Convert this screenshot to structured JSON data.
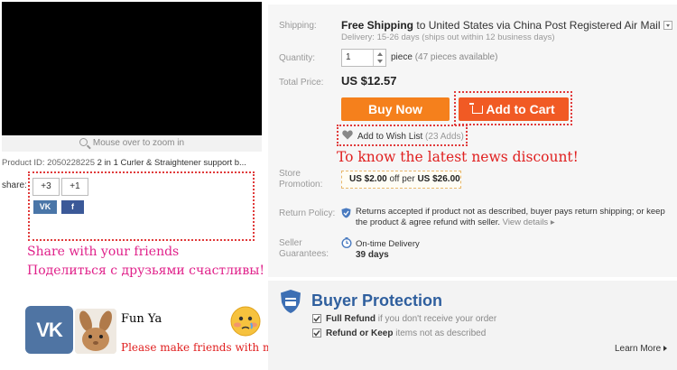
{
  "gallery": {
    "zoom_hint": "Mouse over to zoom in",
    "product_id_label": "Product ID: 2050228225",
    "product_title": "2 in 1 Curler & Straightener support b..."
  },
  "share": {
    "label": "share:",
    "gplus_count": "+3",
    "plus_one": "+1",
    "vk_label": "VK",
    "fb_label": "f",
    "caption_en": "Share with your friends",
    "caption_ru": "Поделиться с друзьями счастливы!"
  },
  "friends": {
    "vk_logo": "VK",
    "name": "Fun Ya",
    "message": "Please make friends with me !"
  },
  "product": {
    "shipping_label": "Shipping:",
    "shipping_main": "Free Shipping",
    "shipping_rest": "to United States via China Post Registered Air Mail",
    "delivery": "Delivery: 15-26 days (ships out within 12 business days)",
    "quantity_label": "Quantity:",
    "quantity_value": "1",
    "quantity_unit": "piece",
    "quantity_available": "(47 pieces available)",
    "total_price_label": "Total Price:",
    "total_price": "US $12.57",
    "buy_now": "Buy Now",
    "add_to_cart": "Add to Cart",
    "wishlist": "Add to Wish List",
    "wishlist_count": "(23 Adds)",
    "news_note": "To know the latest news discount!",
    "store_promo_label_1": "Store",
    "store_promo_label_2": "Promotion:",
    "promo_discount": "US $2.00",
    "promo_mid": "off per",
    "promo_threshold": "US $26.00",
    "return_label": "Return Policy:",
    "return_text": "Returns accepted if product not as described, buyer pays return shipping; or keep the product & agree refund with seller.",
    "return_more": "View details",
    "seller_label_1": "Seller",
    "seller_label_2": "Guarantees:",
    "ontime": "On-time Delivery",
    "ontime_days": "39 days"
  },
  "buyer_protection": {
    "title": "Buyer Protection",
    "full_refund": "Full Refund",
    "full_refund_desc": "if you don't receive your order",
    "refund_keep": "Refund or Keep",
    "refund_keep_desc": "items not as described",
    "learn_more": "Learn More"
  },
  "colors": {
    "buy_now": "#f5801c",
    "add_to_cart": "#f15a24",
    "highlight_dots": "#e03a3a",
    "pink_text": "#e0218a",
    "red_text": "#e02020",
    "vk_blue": "#4f74a3",
    "bp_blue": "#2f5f9e"
  },
  "icons": [
    "magnifier-icon",
    "sort-arrow-icon",
    "cart-icon",
    "heart-icon",
    "shield-icon",
    "clock-icon",
    "check-icon",
    "emoji-icon"
  ]
}
